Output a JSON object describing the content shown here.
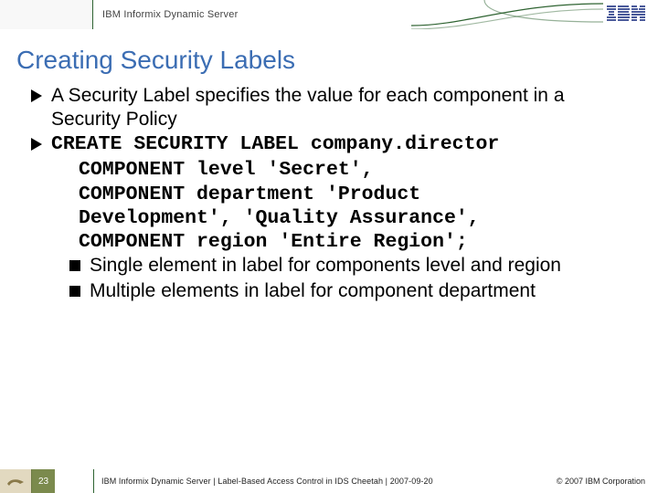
{
  "header": {
    "title": "IBM Informix Dynamic Server",
    "logo": "IBM"
  },
  "title": "Creating Security Labels",
  "bullets": {
    "b1": "A Security Label specifies the value for each component in a Security Policy",
    "b2": "CREATE SECURITY LABEL company.director",
    "code": {
      "l1": "COMPONENT level 'Secret',",
      "l2": "COMPONENT department 'Product",
      "l3": " Development', 'Quality Assurance',",
      "l4": "COMPONENT region 'Entire Region';"
    },
    "sub1": "Single element in label for components level and region",
    "sub2": "Multiple elements in label for component department"
  },
  "footer": {
    "page": "23",
    "text": "IBM Informix Dynamic Server  |  Label-Based Access Control in IDS Cheetah | 2007-09-20",
    "copy": "© 2007 IBM Corporation"
  }
}
